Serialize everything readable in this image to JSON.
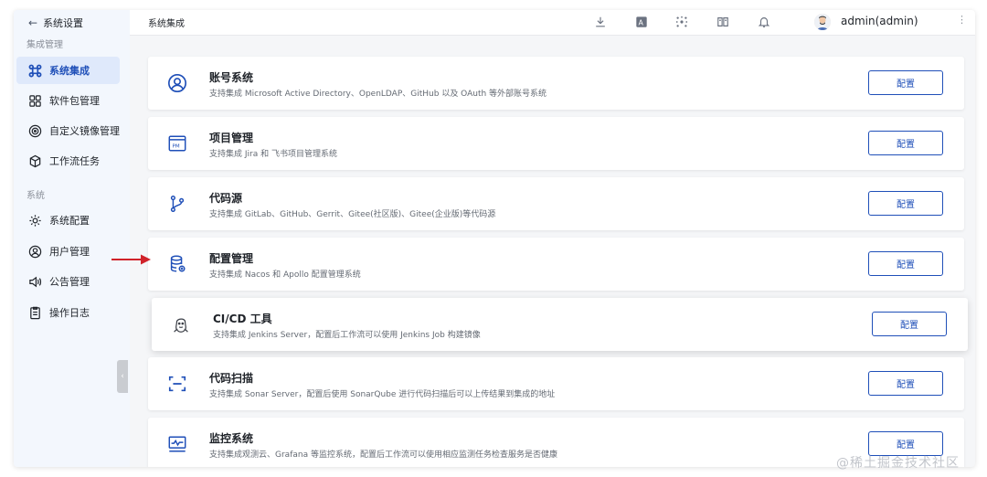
{
  "sidebar": {
    "back_label": "系统设置",
    "groups": [
      {
        "label": "集成管理"
      },
      {
        "label": "系统"
      }
    ],
    "items": [
      {
        "label": "系统集成",
        "icon": "command-icon",
        "active": true
      },
      {
        "label": "软件包管理",
        "icon": "grid-icon"
      },
      {
        "label": "自定义镜像管理",
        "icon": "disc-icon"
      },
      {
        "label": "工作流任务",
        "icon": "cube-icon"
      },
      {
        "label": "系统配置",
        "icon": "gear-icon"
      },
      {
        "label": "用户管理",
        "icon": "user-icon"
      },
      {
        "label": "公告管理",
        "icon": "speaker-icon"
      },
      {
        "label": "操作日志",
        "icon": "document-icon"
      }
    ],
    "collapse_glyph": "‹"
  },
  "header": {
    "breadcrumb": "系统集成",
    "tools": [
      "download-icon",
      "translate-icon",
      "network-icon",
      "book-icon",
      "bell-icon"
    ],
    "user": "admin(admin)",
    "more": "⋮"
  },
  "cards": [
    {
      "title": "账号系统",
      "desc": "支持集成 Microsoft Active Directory、OpenLDAP、GitHub 以及 OAuth 等外部账号系统",
      "button": "配置",
      "icon": "user-circle-icon"
    },
    {
      "title": "项目管理",
      "desc": "支持集成 Jira 和 飞书项目管理系统",
      "button": "配置",
      "icon": "pm-icon"
    },
    {
      "title": "代码源",
      "desc": "支持集成 GitLab、GitHub、Gerrit、Gitee(社区版)、Gitee(企业版)等代码源",
      "button": "配置",
      "icon": "git-branch-icon"
    },
    {
      "title": "配置管理",
      "desc": "支持集成 Nacos 和 Apollo 配置管理系统",
      "button": "配置",
      "icon": "database-icon"
    },
    {
      "title": "CI/CD 工具",
      "desc": "支持集成 Jenkins Server，配置后工作流可以使用 Jenkins Job 构建镜像",
      "button": "配置",
      "icon": "jenkins-icon"
    },
    {
      "title": "代码扫描",
      "desc": "支持集成 Sonar Server，配置后使用 SonarQube 进行代码扫描后可以上传结果到集成的地址",
      "button": "配置",
      "icon": "scan-icon"
    },
    {
      "title": "监控系统",
      "desc": "支持集成观测云、Grafana 等监控系统，配置后工作流可以使用相应监测任务检查服务是否健康",
      "button": "配置",
      "icon": "monitor-icon"
    }
  ],
  "colors": {
    "accent": "#1f4fb8",
    "arrow": "#d0222a"
  },
  "watermark": "@稀土掘金技术社区"
}
